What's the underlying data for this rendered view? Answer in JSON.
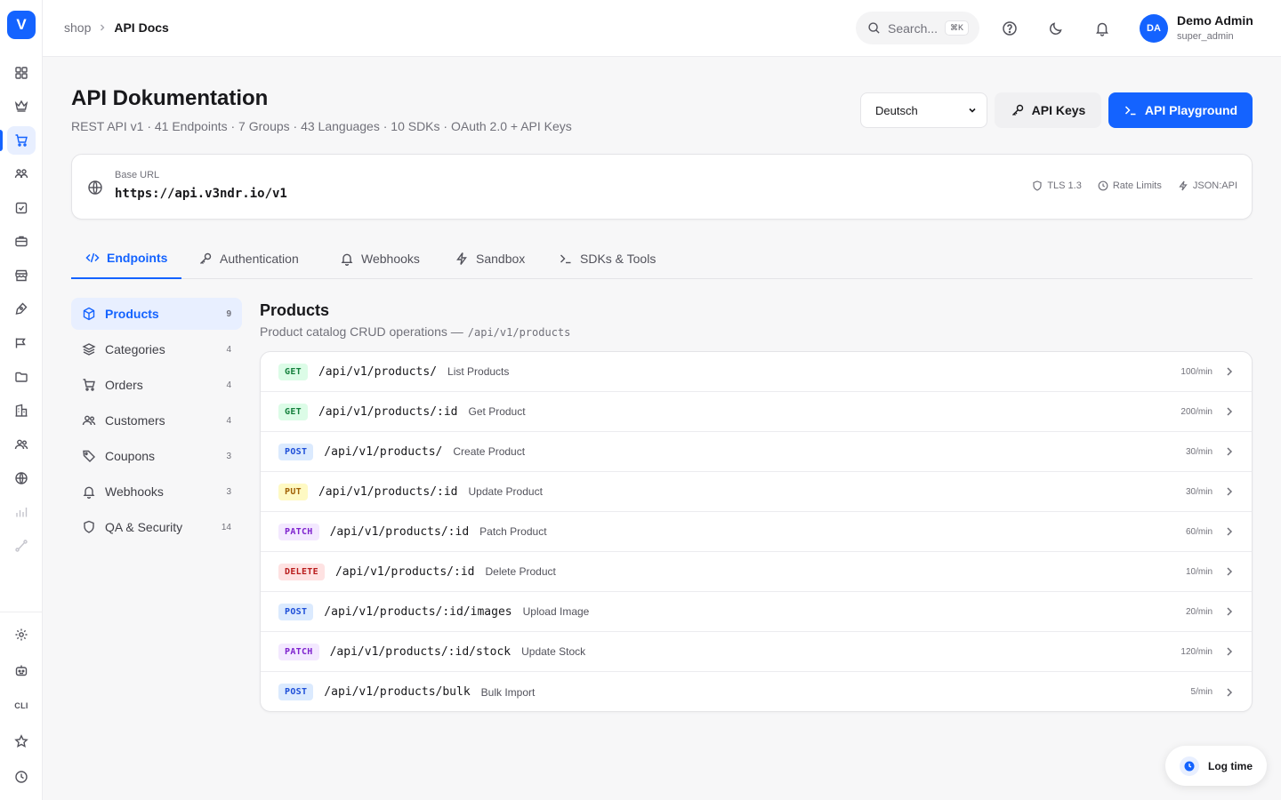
{
  "app": {
    "logo_letter": "V",
    "accent": "#1463ff"
  },
  "rail": {
    "cli_label": "CLI"
  },
  "header": {
    "breadcrumb": {
      "parent": "shop",
      "separator": ">",
      "current": "API Docs"
    },
    "search": {
      "placeholder": "Search...",
      "shortcut": "⌘K"
    },
    "user": {
      "initials": "DA",
      "name": "Demo Admin",
      "role": "super_admin"
    }
  },
  "page": {
    "title": "API Dokumentation",
    "subtitle": "REST API v1 · 41 Endpoints · 7 Groups · 43 Languages · 10 SDKs · OAuth 2.0 + API Keys",
    "language_select": "Deutsch",
    "api_keys_label": "API Keys",
    "playground_label": "API Playground"
  },
  "base_url": {
    "label": "Base URL",
    "value": "https://api.v3ndr.io/v1",
    "meta": [
      "TLS 1.3",
      "Rate Limits",
      "JSON:API"
    ]
  },
  "tabs": [
    "Endpoints",
    "Authentication",
    "Webhooks",
    "Sandbox",
    "SDKs & Tools"
  ],
  "groups": [
    {
      "label": "Products",
      "count": "9",
      "icon": "box-icon"
    },
    {
      "label": "Categories",
      "count": "4",
      "icon": "layers-icon"
    },
    {
      "label": "Orders",
      "count": "4",
      "icon": "cart-icon"
    },
    {
      "label": "Customers",
      "count": "4",
      "icon": "users-icon"
    },
    {
      "label": "Coupons",
      "count": "3",
      "icon": "tag-icon"
    },
    {
      "label": "Webhooks",
      "count": "3",
      "icon": "bell-icon"
    },
    {
      "label": "QA & Security",
      "count": "14",
      "icon": "shield-icon"
    }
  ],
  "section": {
    "title": "Products",
    "description": "Product catalog CRUD operations —",
    "path": "/api/v1/products"
  },
  "endpoints": [
    {
      "method": "GET",
      "path": "/api/v1/products/",
      "name": "List Products",
      "rate": "100/min"
    },
    {
      "method": "GET",
      "path": "/api/v1/products/:id",
      "name": "Get Product",
      "rate": "200/min"
    },
    {
      "method": "POST",
      "path": "/api/v1/products/",
      "name": "Create Product",
      "rate": "30/min"
    },
    {
      "method": "PUT",
      "path": "/api/v1/products/:id",
      "name": "Update Product",
      "rate": "30/min"
    },
    {
      "method": "PATCH",
      "path": "/api/v1/products/:id",
      "name": "Patch Product",
      "rate": "60/min"
    },
    {
      "method": "DELETE",
      "path": "/api/v1/products/:id",
      "name": "Delete Product",
      "rate": "10/min"
    },
    {
      "method": "POST",
      "path": "/api/v1/products/:id/images",
      "name": "Upload Image",
      "rate": "20/min"
    },
    {
      "method": "PATCH",
      "path": "/api/v1/products/:id/stock",
      "name": "Update Stock",
      "rate": "120/min"
    },
    {
      "method": "POST",
      "path": "/api/v1/products/bulk",
      "name": "Bulk Import",
      "rate": "5/min"
    }
  ],
  "floating": {
    "log_time_label": "Log time"
  }
}
